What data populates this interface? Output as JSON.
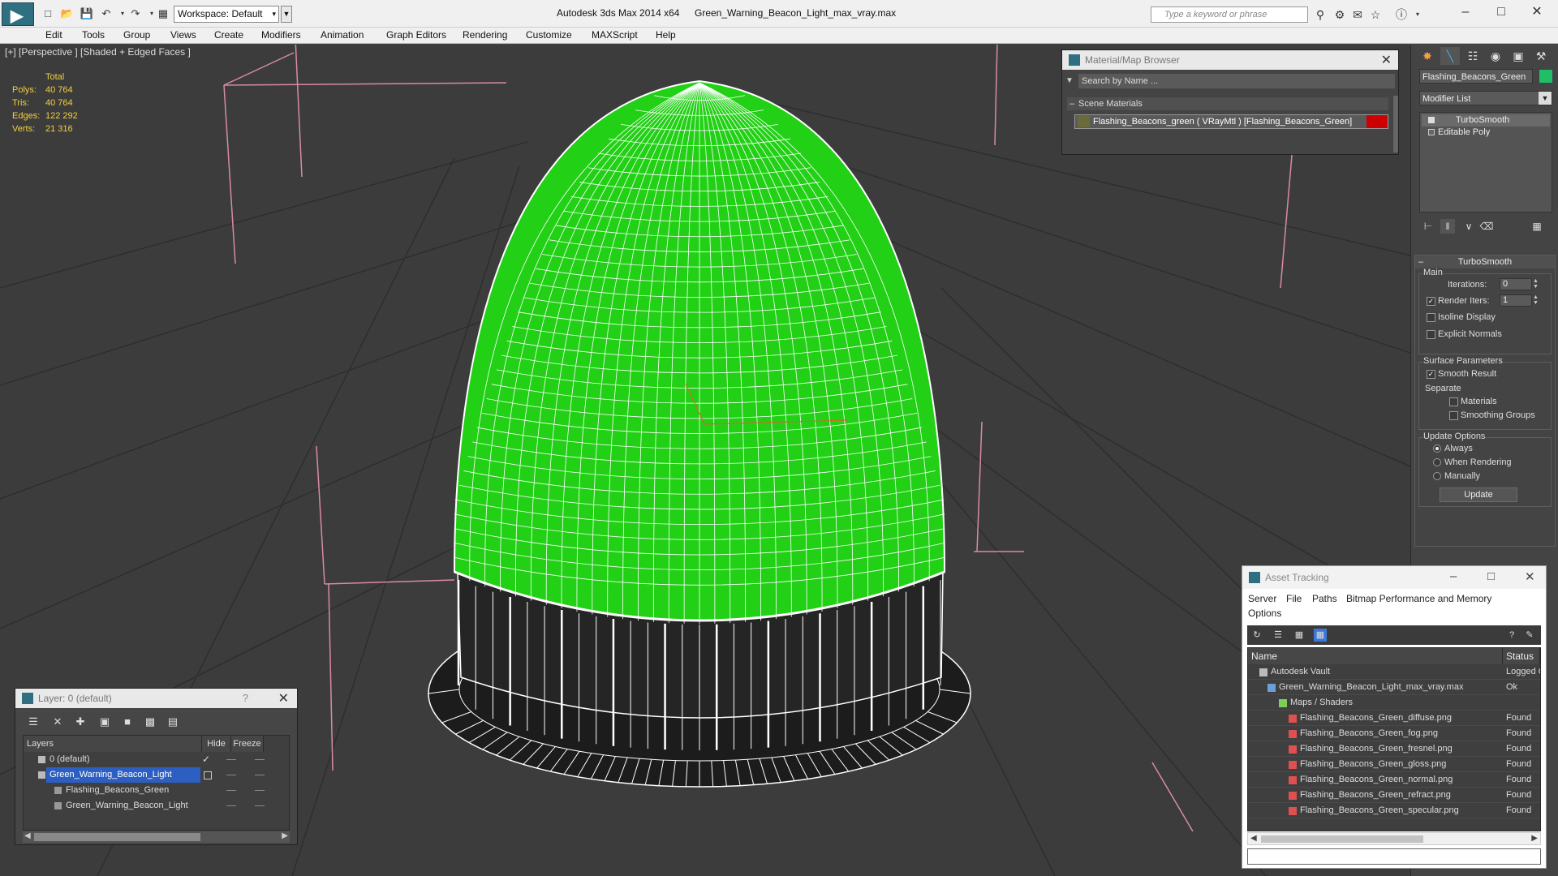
{
  "titlebar": {
    "workspace": "Workspace: Default",
    "app_title": "Autodesk 3ds Max  2014 x64",
    "file_title": "Green_Warning_Beacon_Light_max_vray.max",
    "search_placeholder": "Type a keyword or phrase"
  },
  "menu": [
    "Edit",
    "Tools",
    "Group",
    "Views",
    "Create",
    "Modifiers",
    "Animation",
    "Graph Editors",
    "Rendering",
    "Customize",
    "MAXScript",
    "Help"
  ],
  "viewport": {
    "label": "[+] [Perspective ] [Shaded + Edged Faces ]",
    "stats_header": "Total",
    "stats": [
      {
        "k": "Polys:",
        "v": "40 764"
      },
      {
        "k": "Tris:",
        "v": "40 764"
      },
      {
        "k": "Edges:",
        "v": "122 292"
      },
      {
        "k": "Verts:",
        "v": "21 316"
      }
    ],
    "dome_color": "#22d016",
    "wire_color": "#ffffff",
    "grid_color": "#2e2e2e",
    "bg_color": "#3c3c3c"
  },
  "material_browser": {
    "title": "Material/Map Browser",
    "search_placeholder": "Search by Name ...",
    "section": "Scene Materials",
    "item": "Flashing_Beacons_green ( VRayMtl ) [Flashing_Beacons_Green]",
    "swatch_color": "#cc0000"
  },
  "command_panel": {
    "object_name": "Flashing_Beacons_Green",
    "object_color": "#1fbf68",
    "modifier_list": "Modifier List",
    "stack": [
      "TurboSmooth",
      "Editable Poly"
    ],
    "rollout_title": "TurboSmooth",
    "main_group": "Main",
    "iterations_label": "Iterations:",
    "iterations_value": "0",
    "render_iters_label": "Render Iters:",
    "render_iters_value": "1",
    "render_iters_checked": true,
    "isoline_label": "Isoline Display",
    "explicit_normals_label": "Explicit Normals",
    "surface_group": "Surface Parameters",
    "smooth_result_label": "Smooth Result",
    "separate_label": "Separate",
    "materials_label": "Materials",
    "smoothing_groups_label": "Smoothing Groups",
    "update_group": "Update Options",
    "always_label": "Always",
    "when_rendering_label": "When Rendering",
    "manually_label": "Manually",
    "update_button": "Update"
  },
  "layer_manager": {
    "title": "Layer: 0 (default)",
    "help": "?",
    "col_layers": "Layers",
    "col_hide": "Hide",
    "col_freeze": "Freeze",
    "rows": [
      "0 (default)",
      "Green_Warning_Beacon_Light",
      "Flashing_Beacons_Green",
      "Green_Warning_Beacon_Light"
    ]
  },
  "asset_tracking": {
    "title": "Asset Tracking",
    "menus": [
      "Server",
      "File",
      "Paths",
      "Bitmap Performance and Memory",
      "Options"
    ],
    "col_name": "Name",
    "col_status": "Status",
    "rows": [
      {
        "name": "Autodesk Vault",
        "status": "Logged C"
      },
      {
        "name": "Green_Warning_Beacon_Light_max_vray.max",
        "status": "Ok"
      },
      {
        "name": "Maps / Shaders",
        "status": ""
      },
      {
        "name": "Flashing_Beacons_Green_diffuse.png",
        "status": "Found"
      },
      {
        "name": "Flashing_Beacons_Green_fog.png",
        "status": "Found"
      },
      {
        "name": "Flashing_Beacons_Green_fresnel.png",
        "status": "Found"
      },
      {
        "name": "Flashing_Beacons_Green_gloss.png",
        "status": "Found"
      },
      {
        "name": "Flashing_Beacons_Green_normal.png",
        "status": "Found"
      },
      {
        "name": "Flashing_Beacons_Green_refract.png",
        "status": "Found"
      },
      {
        "name": "Flashing_Beacons_Green_specular.png",
        "status": "Found"
      }
    ]
  }
}
